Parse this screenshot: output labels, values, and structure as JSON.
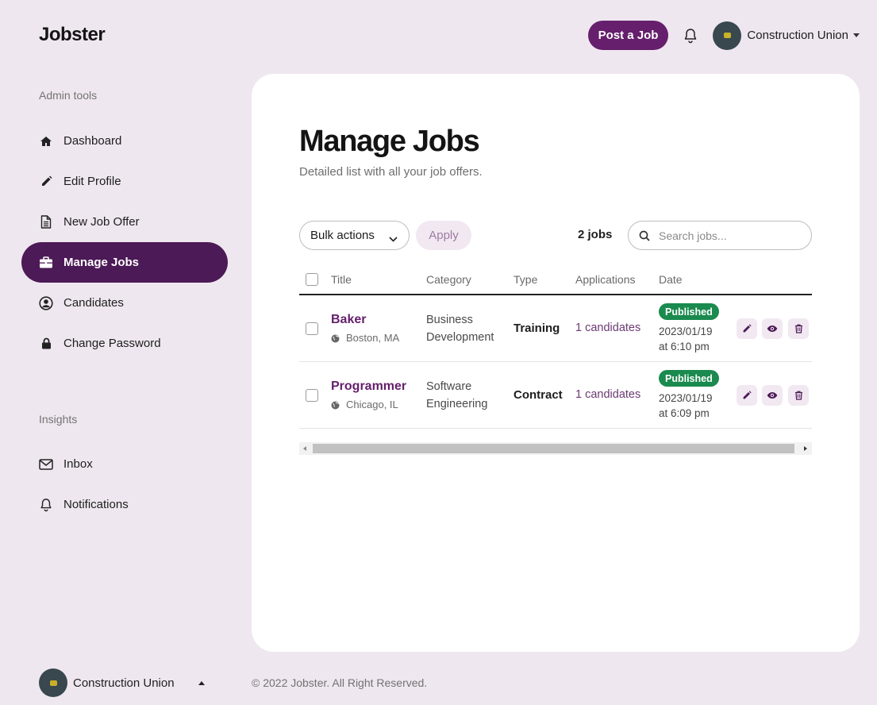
{
  "app": {
    "logo": "Jobster"
  },
  "header": {
    "post_job_label": "Post a Job",
    "user_name": "Construction Union"
  },
  "sidebar": {
    "sections": [
      {
        "label": "Admin tools",
        "items": [
          {
            "label": "Dashboard",
            "icon": "home-icon"
          },
          {
            "label": "Edit Profile",
            "icon": "pencil-icon"
          },
          {
            "label": "New Job Offer",
            "icon": "document-icon"
          },
          {
            "label": "Manage Jobs",
            "icon": "briefcase-icon",
            "active": true
          },
          {
            "label": "Candidates",
            "icon": "user-circle-icon"
          },
          {
            "label": "Change Password",
            "icon": "lock-icon"
          }
        ]
      },
      {
        "label": "Insights",
        "items": [
          {
            "label": "Inbox",
            "icon": "envelope-icon"
          },
          {
            "label": "Notifications",
            "icon": "bell-icon"
          }
        ]
      }
    ],
    "user_name": "Construction Union"
  },
  "main": {
    "title": "Manage Jobs",
    "subtitle": "Detailed list with all your job offers.",
    "bulk_actions_label": "Bulk actions",
    "apply_label": "Apply",
    "job_count": "2 jobs",
    "search_placeholder": "Search jobs...",
    "columns": [
      "Title",
      "Category",
      "Type",
      "Applications",
      "Date"
    ],
    "rows": [
      {
        "title": "Baker",
        "location": "Boston, MA",
        "category_line1": "Business",
        "category_line2": "Development",
        "type": "Training",
        "applications": "1 candidates",
        "status": "Published",
        "date_line1": "2023/01/19",
        "date_line2": "at 6:10 pm"
      },
      {
        "title": "Programmer",
        "location": "Chicago, IL",
        "category_line1": "Software",
        "category_line2": "Engineering",
        "type": "Contract",
        "applications": "1 candidates",
        "status": "Published",
        "date_line1": "2023/01/19",
        "date_line2": "at 6:09 pm"
      }
    ]
  },
  "footer": {
    "text": "© 2022 Jobster. All Right Reserved."
  },
  "colors": {
    "brand": "#651f6c",
    "active_nav": "#4c1a56",
    "published": "#1a8a4e",
    "background": "#efe7ef"
  }
}
